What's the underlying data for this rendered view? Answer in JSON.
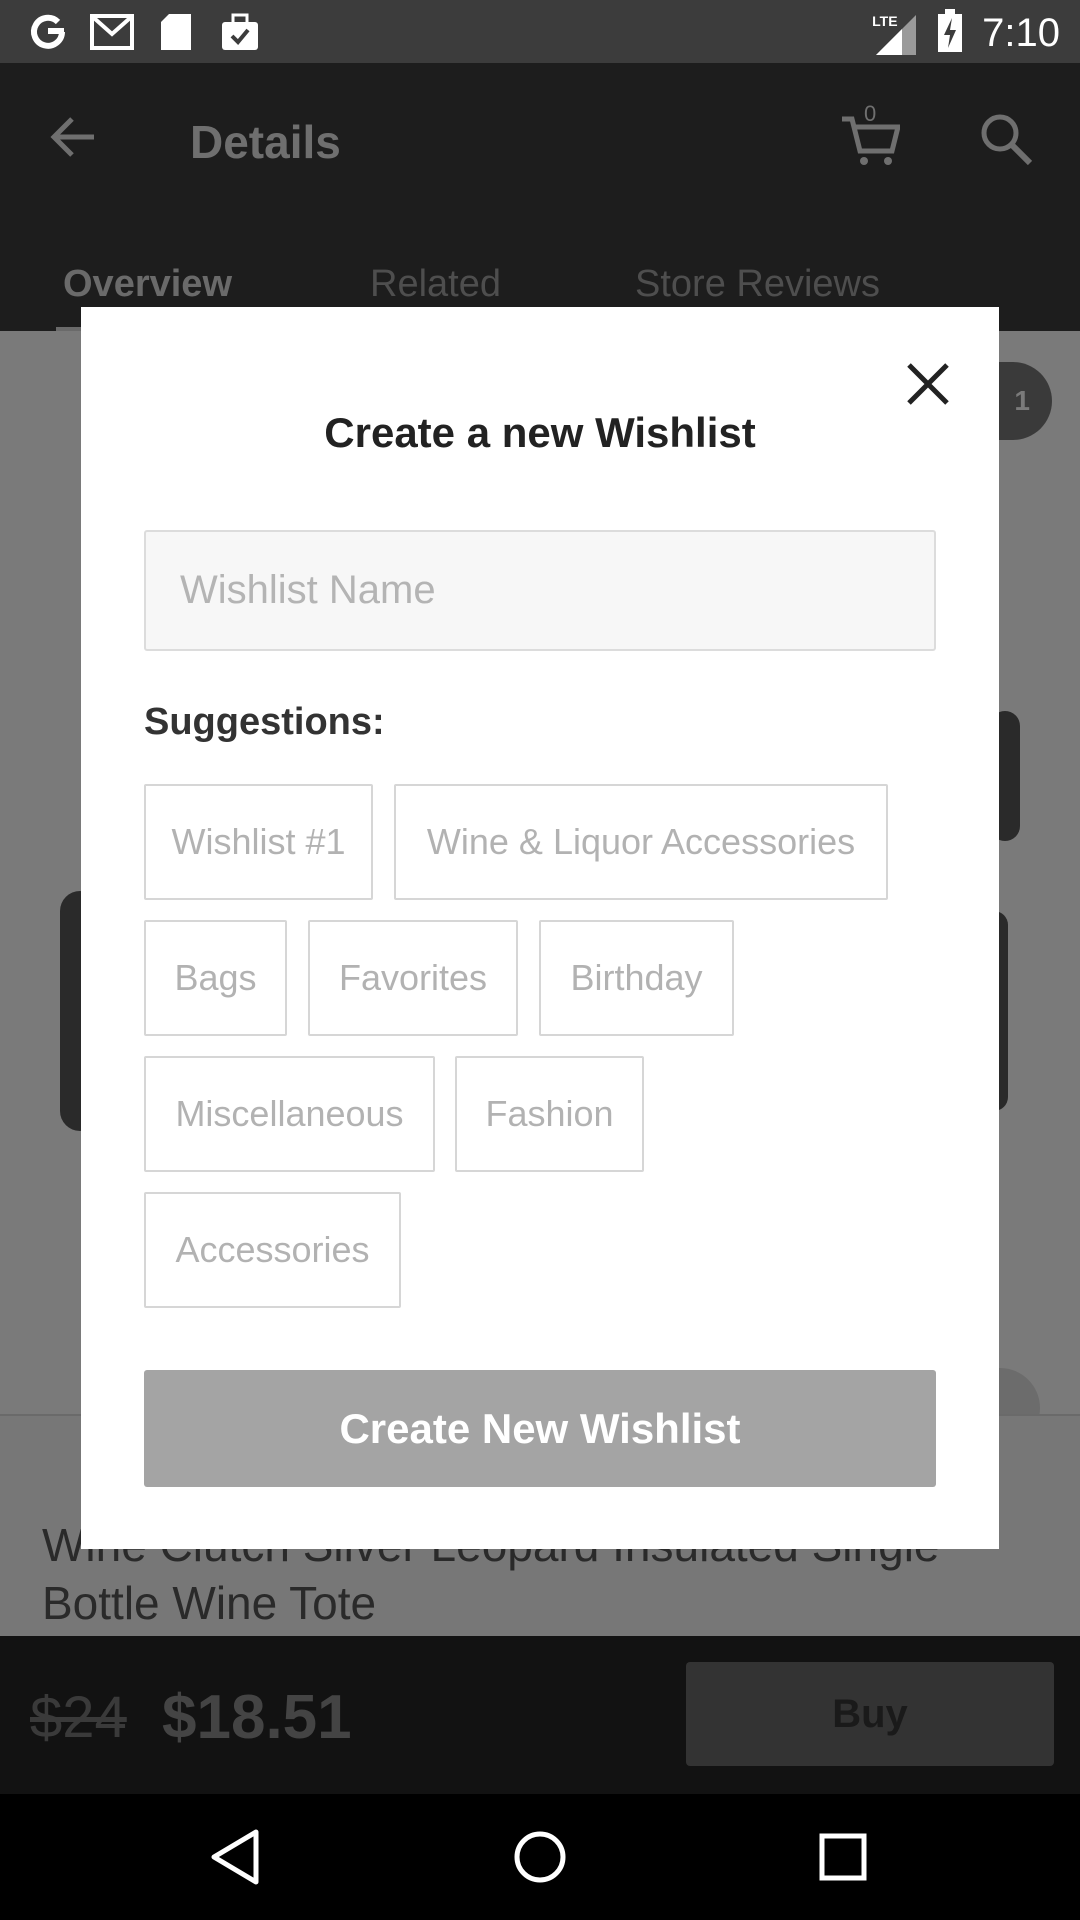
{
  "status_bar": {
    "time": "7:10",
    "network_label": "LTE",
    "left_icons": [
      "google-icon",
      "gmail-icon",
      "sd-card-icon",
      "briefcase-check-icon"
    ],
    "right_icons": [
      "signal-icon",
      "battery-charging-icon"
    ]
  },
  "header": {
    "title": "Details",
    "cart_count": "0",
    "tabs": [
      {
        "label": "Overview",
        "active": true
      },
      {
        "label": "Related",
        "active": false
      },
      {
        "label": "Store Reviews",
        "active": false
      }
    ]
  },
  "product": {
    "badge_count": "1",
    "title": "Wine Clutch Silver Leopard Insulated Single Bottle Wine Tote",
    "old_price": "$24",
    "price": "$18.51",
    "buy_label": "Buy"
  },
  "modal": {
    "title": "Create a new Wishlist",
    "name_placeholder": "Wishlist Name",
    "name_value": "",
    "suggestions_label": "Suggestions:",
    "suggestions": [
      "Wishlist #1",
      "Wine & Liquor Accessories",
      "Bags",
      "Favorites",
      "Birthday",
      "Miscellaneous",
      "Fashion",
      "Accessories"
    ],
    "create_button": "Create New Wishlist"
  },
  "nav": {
    "buttons": [
      "back-triangle-icon",
      "home-circle-icon",
      "recents-square-icon"
    ]
  },
  "colors": {
    "overlay_dark": "#1d1d1d",
    "chip_border": "#d6d6d6",
    "chip_text": "#b2b2b2",
    "button_disabled": "#a4a4a4"
  }
}
